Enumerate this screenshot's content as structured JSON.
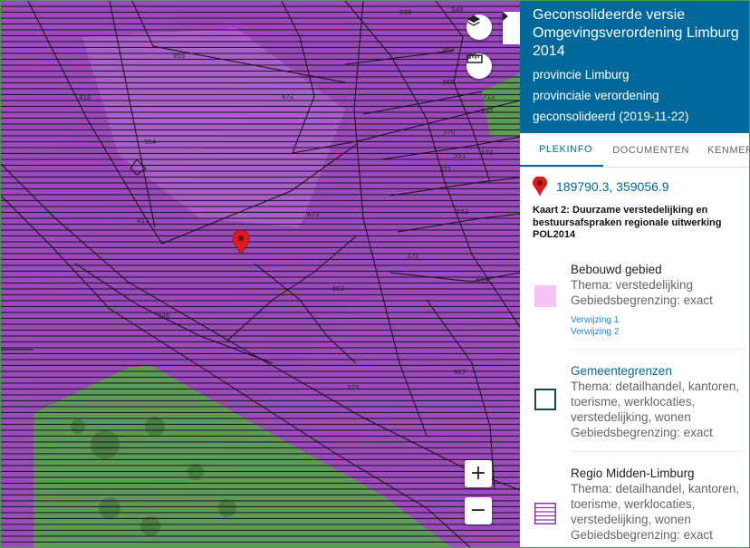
{
  "map": {
    "parcels": [
      {
        "label": "598"
      },
      {
        "label": "549"
      },
      {
        "label": "955"
      },
      {
        "label": "410"
      },
      {
        "label": "672"
      },
      {
        "label": "368"
      },
      {
        "label": "365"
      },
      {
        "label": "713"
      },
      {
        "label": "550"
      },
      {
        "label": "954"
      },
      {
        "label": "370"
      },
      {
        "label": "551"
      },
      {
        "label": "371"
      },
      {
        "label": "552"
      },
      {
        "label": "573"
      },
      {
        "label": "411"
      },
      {
        "label": "673"
      },
      {
        "label": "372"
      },
      {
        "label": "553"
      },
      {
        "label": "603"
      },
      {
        "label": "336"
      },
      {
        "label": "917"
      },
      {
        "label": "373"
      }
    ],
    "controls": {
      "zoom_in": "+",
      "zoom_out": "−"
    },
    "colors": {
      "bebouwd": "#c78be0",
      "regio": "#a43fd0",
      "green": "#59a34a",
      "hatch": "#1b1b2b"
    }
  },
  "panel": {
    "title": "Geconsolideerde versie Omgevingsverordening Limburg 2014",
    "meta": [
      "provincie Limburg",
      "provinciale verordening",
      "geconsolideerd (2019-11-22)"
    ],
    "tabs": [
      "PLEKINFO",
      "DOCUMENTEN",
      "KENMERKEN"
    ],
    "coordinates": "189790.3, 359056.9",
    "kaart_title": "Kaart 2: Duurzame verstedelijking en bestuursafspraken regionale uitwerking POL2014",
    "entries": [
      {
        "name": "Bebouwd gebied",
        "lines": [
          "Thema: verstedelijking",
          "Gebiedsbegrenzing: exact"
        ],
        "links": [
          "Verwijzing 1",
          "Verwijzing 2"
        ]
      },
      {
        "name": "Gemeentegrenzen",
        "lines": [
          "Thema: detailhandel, kantoren,",
          "toerisme, werklocaties,",
          "verstedelijking, wonen",
          "Gebiedsbegrenzing: exact"
        ]
      },
      {
        "name": "Regio Midden-Limburg",
        "lines": [
          "Thema: detailhandel, kantoren,",
          "toerisme, werklocaties,",
          "verstedelijking, wonen",
          "Gebiedsbegrenzing: exact"
        ]
      }
    ],
    "colors": {
      "header": "#01689b",
      "link": "#01689b",
      "swatch_bebouwd": "#f7c4f5",
      "swatch_gemeente": "#184a4a",
      "swatch_regio": "#8e3aa6"
    }
  }
}
